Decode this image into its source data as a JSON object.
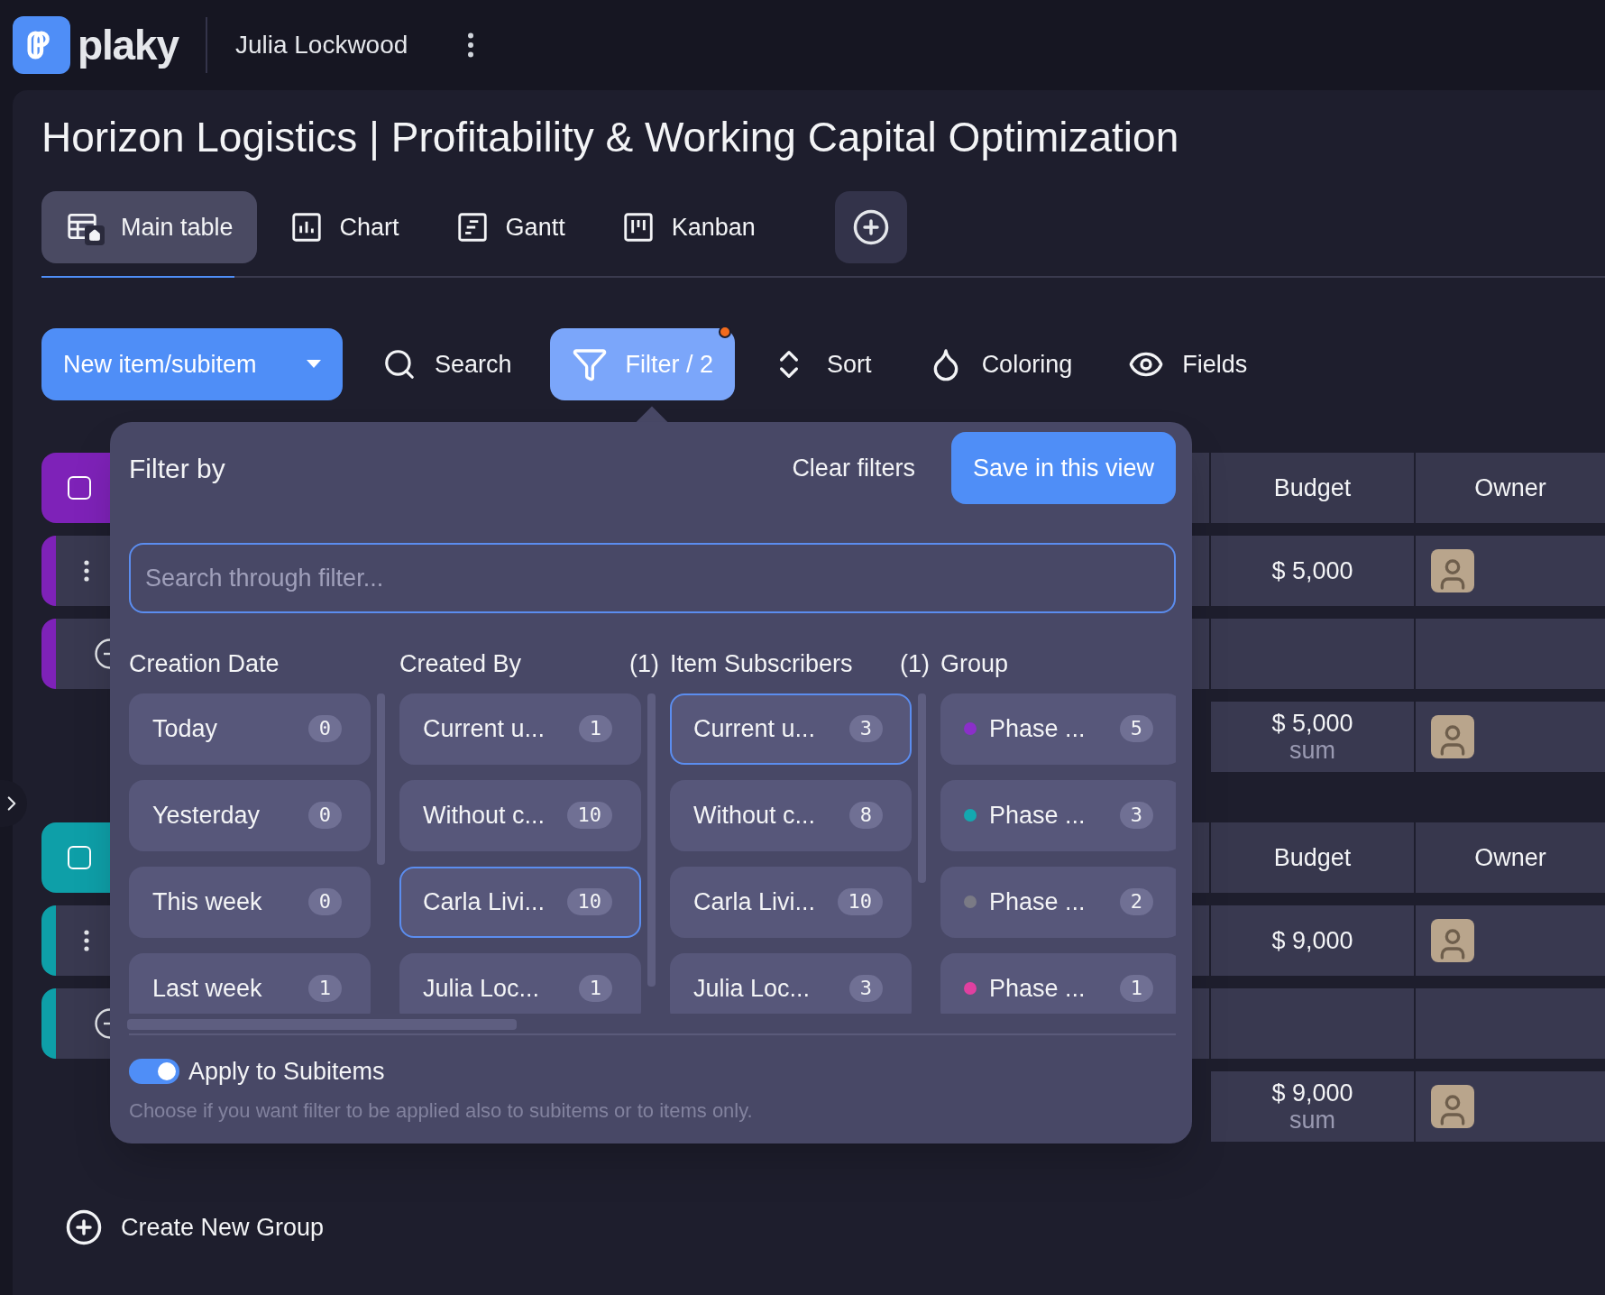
{
  "app": {
    "logo_text": "plaky",
    "user": "Julia Lockwood"
  },
  "board": {
    "title": "Horizon Logistics | Profitability & Working Capital Optimization"
  },
  "views": [
    {
      "label": "Main table",
      "kind": "table",
      "selected": true
    },
    {
      "label": "Chart",
      "kind": "chart",
      "selected": false
    },
    {
      "label": "Gantt",
      "kind": "gantt",
      "selected": false
    },
    {
      "label": "Kanban",
      "kind": "kanban",
      "selected": false
    }
  ],
  "toolbar": {
    "new_button": "New item/subitem",
    "search": "Search",
    "filter": {
      "label": "Filter / 2",
      "active": true,
      "indicator": true
    },
    "sort": "Sort",
    "coloring": "Coloring",
    "fields": "Fields"
  },
  "groups": [
    {
      "color": "#7e22b8",
      "columns": [
        "Budget",
        "Owner"
      ],
      "rows": [
        {
          "kind": "item",
          "budget": "$ 5,000",
          "owner_avatar": true
        },
        {
          "kind": "add"
        },
        {
          "kind": "summary",
          "budget": "$ 5,000",
          "budget_note": "sum",
          "owner_avatar": true
        }
      ]
    },
    {
      "color": "#0e9fa8",
      "columns": [
        "Budget",
        "Owner"
      ],
      "rows": [
        {
          "kind": "item",
          "budget": "$ 9,000",
          "owner_avatar": true
        },
        {
          "kind": "add"
        },
        {
          "kind": "summary",
          "budget": "$ 9,000",
          "budget_note": "sum",
          "owner_avatar": true
        }
      ]
    }
  ],
  "create_group": "Create New Group",
  "filter_panel": {
    "title": "Filter by",
    "clear": "Clear filters",
    "save": "Save in this view",
    "search_placeholder": "Search through filter...",
    "columns": [
      {
        "title": "Creation Date",
        "options": [
          {
            "label": "Today",
            "count": "0",
            "selected": false
          },
          {
            "label": "Yesterday",
            "count": "0",
            "selected": false
          },
          {
            "label": "This week",
            "count": "0",
            "selected": false
          },
          {
            "label": "Last week",
            "count": "1",
            "selected": false
          }
        ]
      },
      {
        "title": "Created By",
        "selected_count": "(1)",
        "options": [
          {
            "label": "Current u...",
            "count": "1",
            "selected": false
          },
          {
            "label": "Without c...",
            "count": "10",
            "selected": false
          },
          {
            "label": "Carla Livi...",
            "count": "10",
            "selected": true
          },
          {
            "label": "Julia Loc...",
            "count": "1",
            "selected": false
          }
        ]
      },
      {
        "title": "Item Subscribers",
        "selected_count": "(1)",
        "options": [
          {
            "label": "Current u...",
            "count": "3",
            "selected": true
          },
          {
            "label": "Without c...",
            "count": "8",
            "selected": false
          },
          {
            "label": "Carla Livi...",
            "count": "10",
            "selected": false
          },
          {
            "label": "Julia Loc...",
            "count": "3",
            "selected": false
          }
        ]
      },
      {
        "title": "Group",
        "options": [
          {
            "label": "Phase ...",
            "count": "5",
            "selected": false,
            "color": "#8b2fc9"
          },
          {
            "label": "Phase ...",
            "count": "3",
            "selected": false,
            "color": "#14a8b0"
          },
          {
            "label": "Phase ...",
            "count": "2",
            "selected": false,
            "color": "#7a7a85"
          },
          {
            "label": "Phase ...",
            "count": "1",
            "selected": false,
            "color": "#e040a0"
          }
        ]
      }
    ],
    "apply_subitems": {
      "label": "Apply to Subitems",
      "on": true
    },
    "hint": "Choose if you want filter to be applied also to subitems or to items only."
  }
}
